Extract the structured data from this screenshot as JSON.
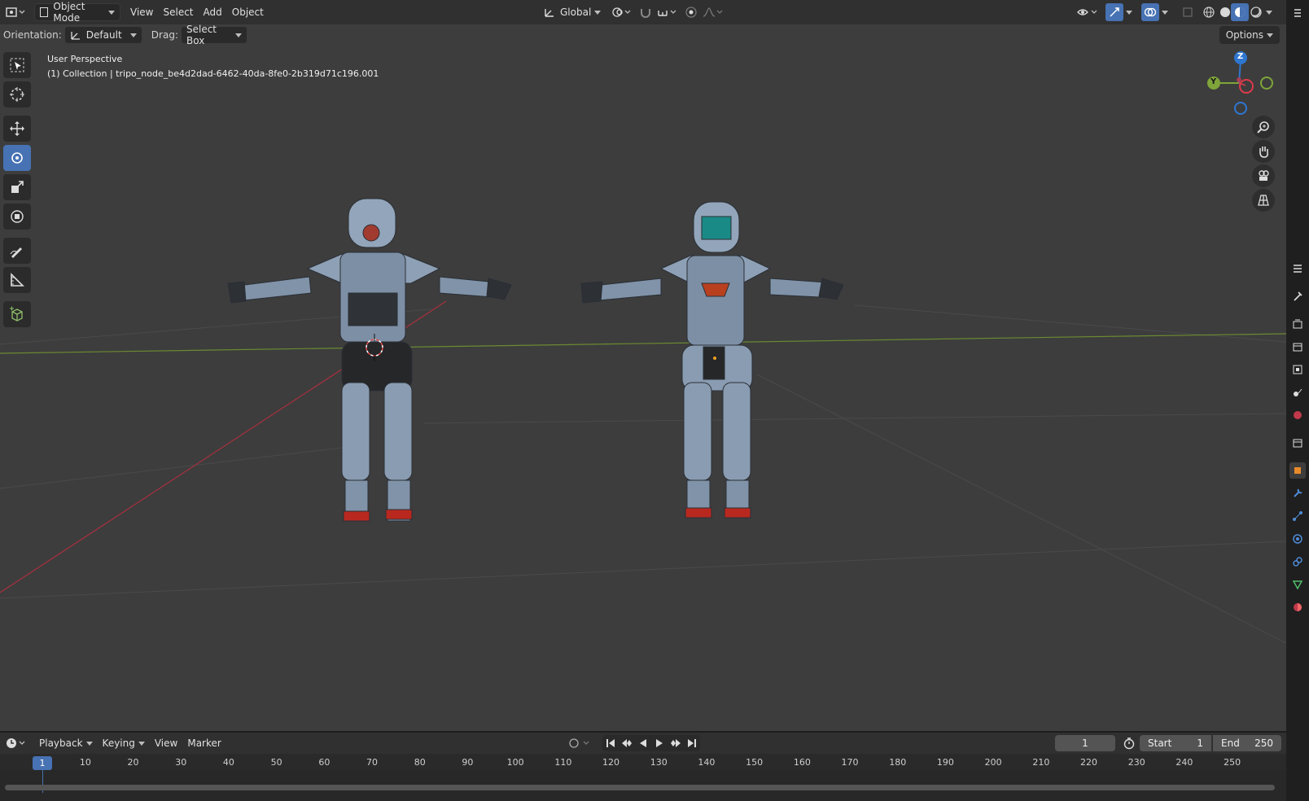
{
  "header": {
    "mode_label": "Object Mode",
    "menus": [
      "View",
      "Select",
      "Add",
      "Object"
    ],
    "transform_orientation": "Global"
  },
  "tool_settings": {
    "orientation_label": "Orientation:",
    "orientation_value": "Default",
    "drag_label": "Drag:",
    "drag_value": "Select Box",
    "options_label": "Options"
  },
  "viewport": {
    "view_name": "User Perspective",
    "collection_info": "(1) Collection | tripo_node_be4d2dad-6462-40da-8fe0-2b319d71c196.001",
    "gizmo_axes": {
      "z": "Z",
      "y": "Y"
    }
  },
  "timeline": {
    "menus": [
      "Playback",
      "Keying",
      "View",
      "Marker"
    ],
    "current_frame": "1",
    "start_label": "Start",
    "start_value": "1",
    "end_label": "End",
    "end_value": "250",
    "ruler_labels": [
      "10",
      "20",
      "30",
      "40",
      "50",
      "60",
      "70",
      "80",
      "90",
      "100",
      "110",
      "120",
      "130",
      "140",
      "150",
      "160",
      "170",
      "180",
      "190",
      "200",
      "210",
      "220",
      "230",
      "240",
      "250"
    ]
  },
  "colors": {
    "accent": "#4772b3",
    "x_axis": "#c0394b",
    "y_axis": "#7fa53a",
    "z_axis": "#2f76d0"
  }
}
